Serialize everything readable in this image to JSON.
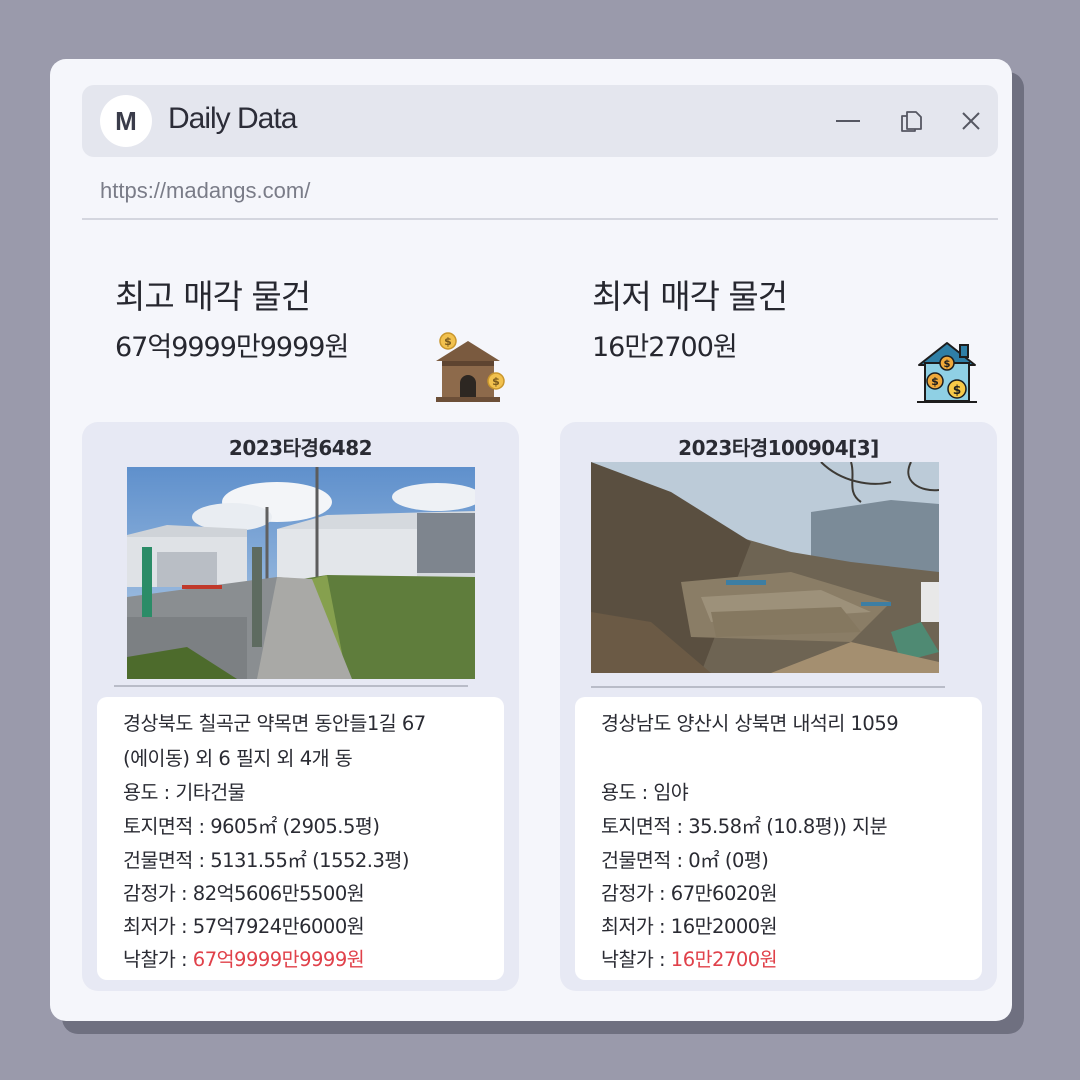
{
  "window": {
    "logo_letter": "M",
    "app_title": "Daily Data",
    "url": "https://madangs.com/"
  },
  "highest": {
    "heading": "최고 매각 물건",
    "price": "67억9999만9999원",
    "icon": "house-money-icon",
    "case_no": "2023타경6482",
    "address_line1": "경상북도 칠곡군 약목면 동안들1길 67",
    "address_line2": "(에이동) 외 6 필지 외 4개 동",
    "use": "용도 : 기타건물",
    "land_area": "토지면적 : 9605㎡ (2905.5평)",
    "building_area": "건물면적 : 5131.55㎡ (1552.3평)",
    "appraisal": "감정가 : 82억5606만5500원",
    "minimum": "최저가 : 57억7924만6000원",
    "winning_label": "낙찰가 : ",
    "winning_value": "67억9999만9999원"
  },
  "lowest": {
    "heading": "최저 매각 물건",
    "price": "16만2700원",
    "icon": "house-coins-icon",
    "case_no": "2023타경100904[3]",
    "address_line1": "경상남도 양산시 상북면 내석리 1059",
    "address_line2": "",
    "use": "용도 : 임야",
    "land_area": "토지면적 : 35.58㎡ (10.8평)) 지분",
    "building_area": "건물면적 : 0㎡ (0평)",
    "appraisal": "감정가 : 67만6020원",
    "minimum": "최저가 : 16만2000원",
    "winning_label": "낙찰가 : ",
    "winning_value": "16만2700원"
  },
  "colors": {
    "background": "#9a9aab",
    "window": "#f5f6fb",
    "titlebar": "#e4e6ee",
    "card": "#e7e9f4",
    "winning_price": "#e0414a"
  }
}
